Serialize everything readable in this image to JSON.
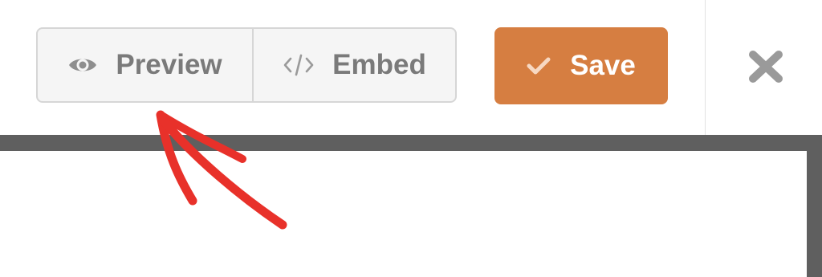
{
  "toolbar": {
    "preview_label": "Preview",
    "embed_label": "Embed",
    "save_label": "Save"
  },
  "icons": {
    "preview": "eye-icon",
    "embed": "code-icon",
    "save": "checkmark-icon",
    "close": "close-icon"
  },
  "colors": {
    "save_button": "#d67e41",
    "annotation_arrow": "#e8312a",
    "frame": "#5f5f5f"
  }
}
